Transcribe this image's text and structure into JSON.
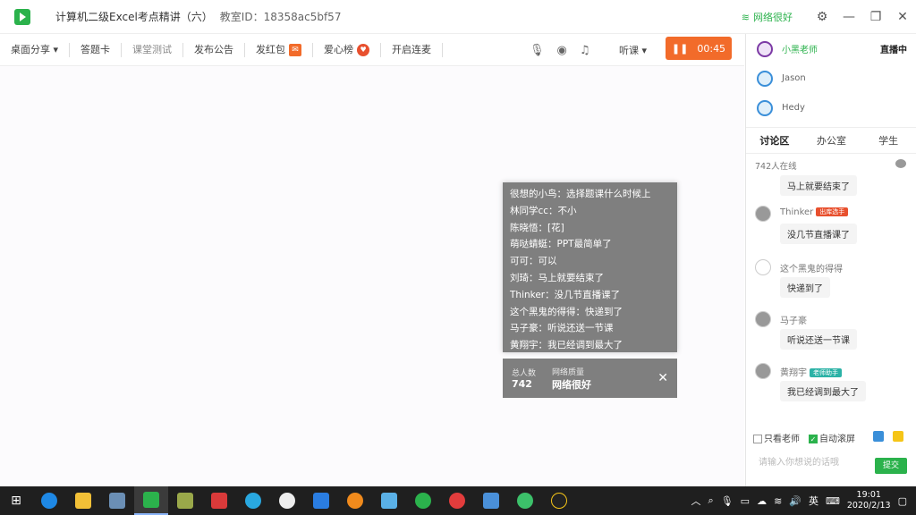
{
  "window": {
    "title": "计算机二级Excel考点精讲（六）",
    "classroom_id": "教室ID：18358ac5bf57",
    "network": "网络很好"
  },
  "toolbar": {
    "desktop_share": "桌面分享 ▾",
    "answer_card": "答题卡",
    "class_test": "课堂测试",
    "announcement": "发布公告",
    "red_packet": "发红包",
    "love_board": "爱心榜",
    "start_mic": "开启连麦",
    "listen": "听课 ▾",
    "timer": "00:45",
    "pause_icon": "❚❚"
  },
  "overlay": {
    "chat_lines": [
      "很想的小鸟：选择题课什么时候上",
      "林同学cc：不小",
      "陈晓悟：[花]",
      "萌哒蜻蜓：PPT最简单了",
      "可可：可以",
      "刘琦：马上就要结束了",
      "Thinker：没几节直播课了",
      "这个黑鬼的得得：快递到了",
      "马子豪：听说还送一节课",
      "黄翔宇：我已经调到最大了"
    ],
    "total_label": "总人数",
    "total_value": "742",
    "quality_label": "网络质量",
    "quality_value": "网络很好",
    "close": "✕"
  },
  "sidebar": {
    "teachers": [
      {
        "name": "小黑老师",
        "status": "直播中"
      },
      {
        "name": "Jason"
      },
      {
        "name": "Hedy"
      }
    ],
    "tabs": [
      "讨论区",
      "办公室",
      "学生"
    ],
    "online": "742人在线",
    "messages": [
      {
        "name": "",
        "text": "马上就要结束了"
      },
      {
        "name": "Thinker",
        "tag": "出库选手",
        "text": "没几节直播课了"
      },
      {
        "name": "这个黑鬼的得得",
        "text": "快递到了"
      },
      {
        "name": "马子豪",
        "text": "听说还送一节课"
      },
      {
        "name": "黄翔宇",
        "tag": "老师助手",
        "text": "我已经调到最大了"
      }
    ],
    "only_teacher": "只看老师",
    "auto_scroll": "自动滚屏",
    "input_placeholder": "请输入你想说的话哦",
    "submit": "提交"
  },
  "taskbar": {
    "tray_lang": "英",
    "time": "19:01",
    "date": "2020/2/13"
  },
  "colors": {
    "accent_green": "#2bb24c",
    "timer_orange": "#f26b2a",
    "overlay_grey": "#7f7f7f"
  }
}
